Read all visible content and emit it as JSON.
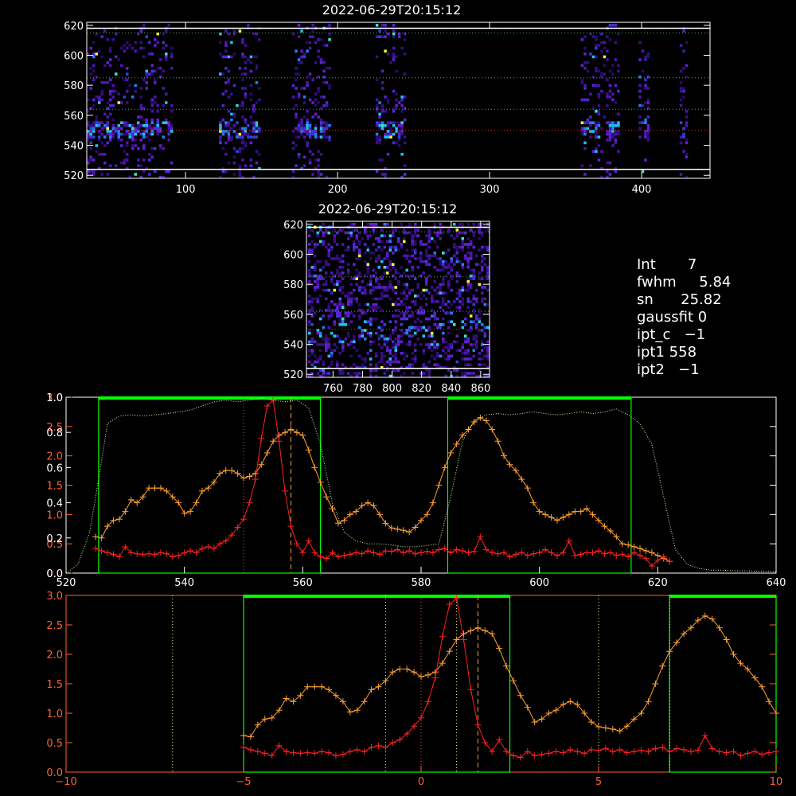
{
  "colors": {
    "background": "#000000",
    "axis": "#ffffff",
    "red": "#ff2020",
    "orange": "#ffa030",
    "green": "#00ff00",
    "lightgreen": "#ccffaa",
    "yellow": "#ffff40"
  },
  "info": {
    "int": {
      "label": "Int",
      "value": "7"
    },
    "fwhm": {
      "label": "fwhm",
      "value": "5.84"
    },
    "sn": {
      "label": "sn",
      "value": "25.82"
    },
    "gaussfit": {
      "label": "gaussfit",
      "value": "0"
    },
    "ipt_c": {
      "label": "ipt_c",
      "value": "−1"
    },
    "ipt1": {
      "label": "ipt1",
      "value": "558"
    },
    "ipt2": {
      "label": "ipt2",
      "value": "−1"
    }
  },
  "chart_data": [
    {
      "type": "heatmap",
      "title": "2022-06-29T20:15:12",
      "xlim": [
        35,
        445
      ],
      "ylim": [
        518,
        622
      ],
      "xticks": [
        100,
        200,
        300,
        400
      ],
      "yticks": [
        520,
        540,
        560,
        580,
        600,
        620
      ],
      "hlines": {
        "white": [
          524,
          618
        ],
        "green": [
          564,
          585,
          615
        ],
        "red": [
          550
        ]
      },
      "bright_columns": [
        [
          35,
          90
        ],
        [
          122,
          148
        ],
        [
          170,
          195
        ],
        [
          225,
          245
        ],
        [
          360,
          385
        ],
        [
          398,
          405
        ],
        [
          425,
          429
        ]
      ]
    },
    {
      "type": "heatmap",
      "title": "2022-06-29T20:15:12",
      "xlim": [
        742,
        866
      ],
      "ylim": [
        518,
        622
      ],
      "xticks": [
        760,
        780,
        800,
        820,
        840,
        860
      ],
      "yticks": [
        520,
        540,
        560,
        580,
        600,
        620
      ],
      "hlines": {
        "white": [
          524,
          618
        ],
        "green": [
          562,
          585,
          615
        ],
        "red": [
          550
        ]
      }
    },
    {
      "type": "line",
      "xlim": [
        520,
        640
      ],
      "xticks": [
        520,
        540,
        560,
        580,
        600,
        620,
        640
      ],
      "yticks_left_red": [
        0.0,
        0.5,
        1.0,
        1.5,
        2.0,
        2.5,
        3.0
      ],
      "yticks_left_white": [
        0.0,
        0.2,
        0.4,
        0.6,
        0.8,
        1.0
      ],
      "ylim": [
        0,
        3.0
      ],
      "green_boxes": [
        [
          525.5,
          563
        ],
        [
          584.5,
          615.5
        ]
      ],
      "vlines": {
        "red_dotted": [
          550
        ],
        "orange_dashed": [
          558
        ]
      },
      "series": [
        {
          "color": "orange",
          "x": [
            525,
            526,
            527,
            528,
            529,
            530,
            531,
            532,
            533,
            534,
            535,
            536,
            537,
            538,
            539,
            540,
            541,
            542,
            543,
            544,
            545,
            546,
            547,
            548,
            549,
            550,
            551,
            552,
            553,
            554,
            555,
            556,
            557,
            558,
            559,
            560,
            561,
            562,
            563,
            564,
            565,
            566,
            567,
            568,
            569,
            570,
            571,
            572,
            573,
            574,
            575,
            576,
            577,
            578,
            579,
            580,
            581,
            582,
            583,
            584,
            585,
            586,
            587,
            588,
            589,
            590,
            591,
            592,
            593,
            594,
            595,
            596,
            597,
            598,
            599,
            600,
            601,
            602,
            603,
            604,
            605,
            606,
            607,
            608,
            609,
            610,
            611,
            612,
            613,
            614,
            615,
            616,
            617,
            618,
            619,
            620,
            621,
            622
          ],
          "values": [
            0.62,
            0.6,
            0.8,
            0.9,
            0.92,
            1.05,
            1.25,
            1.2,
            1.3,
            1.45,
            1.45,
            1.45,
            1.4,
            1.3,
            1.2,
            1.02,
            1.05,
            1.2,
            1.4,
            1.45,
            1.55,
            1.7,
            1.75,
            1.75,
            1.7,
            1.62,
            1.65,
            1.7,
            1.85,
            2.05,
            2.25,
            2.35,
            2.4,
            2.45,
            2.4,
            2.35,
            2.1,
            1.8,
            1.55,
            1.3,
            1.1,
            0.85,
            0.9,
            1.0,
            1.05,
            1.15,
            1.2,
            1.15,
            1.0,
            0.85,
            0.77,
            0.75,
            0.73,
            0.7,
            0.78,
            0.9,
            1.0,
            1.2,
            1.5,
            1.8,
            2.05,
            2.2,
            2.35,
            2.45,
            2.58,
            2.65,
            2.6,
            2.45,
            2.25,
            2.0,
            1.85,
            1.75,
            1.6,
            1.45,
            1.2,
            1.05,
            1.0,
            0.95,
            0.9,
            0.95,
            1.0,
            1.05,
            1.05,
            1.1,
            1.0,
            0.9,
            0.8,
            0.72,
            0.62,
            0.5,
            0.48,
            0.45,
            0.42,
            0.38,
            0.35,
            0.3,
            0.25,
            0.2
          ]
        },
        {
          "color": "red",
          "x": [
            525,
            526,
            527,
            528,
            529,
            530,
            531,
            532,
            533,
            534,
            535,
            536,
            537,
            538,
            539,
            540,
            541,
            542,
            543,
            544,
            545,
            546,
            547,
            548,
            549,
            550,
            551,
            552,
            553,
            554,
            555,
            556,
            557,
            558,
            559,
            560,
            561,
            562,
            563,
            564,
            565,
            566,
            567,
            568,
            569,
            570,
            571,
            572,
            573,
            574,
            575,
            576,
            577,
            578,
            579,
            580,
            581,
            582,
            583,
            584,
            585,
            586,
            587,
            588,
            589,
            590,
            591,
            592,
            593,
            594,
            595,
            596,
            597,
            598,
            599,
            600,
            601,
            602,
            603,
            604,
            605,
            606,
            607,
            608,
            609,
            610,
            611,
            612,
            613,
            614,
            615,
            616,
            617,
            618,
            619,
            620,
            621,
            622
          ],
          "values": [
            0.42,
            0.38,
            0.35,
            0.32,
            0.28,
            0.45,
            0.35,
            0.33,
            0.32,
            0.33,
            0.32,
            0.35,
            0.33,
            0.28,
            0.3,
            0.35,
            0.38,
            0.35,
            0.42,
            0.45,
            0.42,
            0.5,
            0.55,
            0.65,
            0.78,
            0.92,
            1.2,
            1.6,
            2.3,
            2.85,
            2.95,
            2.25,
            1.4,
            0.8,
            0.5,
            0.35,
            0.55,
            0.35,
            0.28,
            0.25,
            0.35,
            0.28,
            0.3,
            0.32,
            0.35,
            0.33,
            0.38,
            0.35,
            0.32,
            0.38,
            0.37,
            0.4,
            0.35,
            0.38,
            0.33,
            0.35,
            0.37,
            0.35,
            0.4,
            0.42,
            0.35,
            0.4,
            0.38,
            0.35,
            0.37,
            0.62,
            0.4,
            0.35,
            0.33,
            0.35,
            0.28,
            0.32,
            0.35,
            0.3,
            0.33,
            0.35,
            0.4,
            0.35,
            0.3,
            0.35,
            0.55,
            0.3,
            0.32,
            0.35,
            0.35,
            0.38,
            0.33,
            0.35,
            0.3,
            0.32,
            0.28,
            0.35,
            0.3,
            0.25,
            0.12,
            0.22,
            0.28,
            0.2
          ]
        },
        {
          "color": "lightgreen",
          "style": "dotted",
          "x": [
            520,
            522,
            524,
            525.5,
            527,
            529,
            531,
            533,
            535,
            537,
            539,
            541,
            543,
            545,
            547,
            549,
            551,
            553,
            555,
            557,
            559,
            561,
            563,
            565,
            567,
            569,
            571,
            573,
            575,
            577,
            579,
            581,
            583,
            585,
            587,
            589,
            591,
            593,
            595,
            597,
            599,
            601,
            603,
            605,
            607,
            609,
            611,
            613,
            615,
            617,
            619,
            621,
            623,
            625,
            627,
            629,
            631,
            633,
            635,
            637,
            639,
            640
          ],
          "values": [
            0.0,
            0.15,
            0.7,
            1.6,
            2.55,
            2.68,
            2.7,
            2.68,
            2.7,
            2.72,
            2.75,
            2.78,
            2.85,
            2.92,
            2.95,
            2.92,
            2.95,
            2.98,
            2.95,
            2.92,
            2.95,
            2.82,
            2.2,
            1.2,
            0.7,
            0.55,
            0.5,
            0.5,
            0.48,
            0.45,
            0.45,
            0.47,
            0.5,
            1.3,
            2.25,
            2.6,
            2.7,
            2.72,
            2.7,
            2.72,
            2.75,
            2.72,
            2.7,
            2.72,
            2.75,
            2.72,
            2.75,
            2.8,
            2.7,
            2.55,
            2.2,
            1.3,
            0.4,
            0.15,
            0.08,
            0.05,
            0.05,
            0.04,
            0.04,
            0.03,
            0.03,
            0.02
          ]
        }
      ]
    },
    {
      "type": "line",
      "xlim": [
        -10,
        10
      ],
      "xticks": [
        -10,
        -5,
        0,
        5,
        10
      ],
      "yticks": [
        0.0,
        0.5,
        1.0,
        1.5,
        2.0,
        2.5,
        3.0
      ],
      "ylim": [
        0,
        3.0
      ],
      "green_boxes": [
        [
          -5,
          2.5
        ],
        [
          7,
          10
        ]
      ],
      "vlines": {
        "yellow_dotted": [
          -7,
          -1,
          1,
          5,
          7
        ],
        "red_dotted": [
          0
        ],
        "orange_dashed": [
          1.6
        ]
      },
      "series": [
        {
          "color": "orange",
          "x": [
            -5.0,
            -4.8,
            -4.6,
            -4.4,
            -4.2,
            -4.0,
            -3.8,
            -3.6,
            -3.4,
            -3.2,
            -3.0,
            -2.8,
            -2.6,
            -2.4,
            -2.2,
            -2.0,
            -1.8,
            -1.6,
            -1.4,
            -1.2,
            -1.0,
            -0.8,
            -0.6,
            -0.4,
            -0.2,
            0.0,
            0.2,
            0.4,
            0.6,
            0.8,
            1.0,
            1.2,
            1.4,
            1.6,
            1.8,
            2.0,
            2.2,
            2.4,
            2.6,
            2.8,
            3.0,
            3.2,
            3.4,
            3.6,
            3.8,
            4.0,
            4.2,
            4.4,
            4.6,
            4.8,
            5.0,
            5.2,
            5.4,
            5.6,
            5.8,
            6.0,
            6.2,
            6.4,
            6.6,
            6.8,
            7.0,
            7.2,
            7.4,
            7.6,
            7.8,
            8.0,
            8.2,
            8.4,
            8.6,
            8.8,
            9.0,
            9.2,
            9.4,
            9.6,
            9.8,
            10.0
          ],
          "values": [
            0.62,
            0.6,
            0.8,
            0.9,
            0.92,
            1.05,
            1.25,
            1.2,
            1.3,
            1.45,
            1.45,
            1.45,
            1.4,
            1.3,
            1.2,
            1.02,
            1.05,
            1.2,
            1.4,
            1.45,
            1.55,
            1.7,
            1.75,
            1.75,
            1.7,
            1.62,
            1.65,
            1.7,
            1.85,
            2.05,
            2.25,
            2.35,
            2.4,
            2.45,
            2.4,
            2.35,
            2.1,
            1.8,
            1.55,
            1.3,
            1.1,
            0.85,
            0.9,
            1.0,
            1.05,
            1.15,
            1.2,
            1.15,
            1.0,
            0.85,
            0.77,
            0.75,
            0.73,
            0.7,
            0.78,
            0.9,
            1.0,
            1.2,
            1.5,
            1.8,
            2.05,
            2.2,
            2.35,
            2.45,
            2.58,
            2.65,
            2.6,
            2.45,
            2.25,
            2.0,
            1.85,
            1.75,
            1.6,
            1.45,
            1.2,
            1.0
          ]
        },
        {
          "color": "red",
          "x": [
            -5.0,
            -4.8,
            -4.6,
            -4.4,
            -4.2,
            -4.0,
            -3.8,
            -3.6,
            -3.4,
            -3.2,
            -3.0,
            -2.8,
            -2.6,
            -2.4,
            -2.2,
            -2.0,
            -1.8,
            -1.6,
            -1.4,
            -1.2,
            -1.0,
            -0.8,
            -0.6,
            -0.4,
            -0.2,
            0.0,
            0.2,
            0.4,
            0.6,
            0.8,
            1.0,
            1.2,
            1.4,
            1.6,
            1.8,
            2.0,
            2.2,
            2.4,
            2.6,
            2.8,
            3.0,
            3.2,
            3.4,
            3.6,
            3.8,
            4.0,
            4.2,
            4.4,
            4.6,
            4.8,
            5.0,
            5.2,
            5.4,
            5.6,
            5.8,
            6.0,
            6.2,
            6.4,
            6.6,
            6.8,
            7.0,
            7.2,
            7.4,
            7.6,
            7.8,
            8.0,
            8.2,
            8.4,
            8.6,
            8.8,
            9.0,
            9.2,
            9.4,
            9.6,
            9.8,
            10.0
          ],
          "values": [
            0.42,
            0.38,
            0.35,
            0.32,
            0.28,
            0.45,
            0.35,
            0.33,
            0.32,
            0.33,
            0.32,
            0.35,
            0.33,
            0.28,
            0.3,
            0.35,
            0.38,
            0.35,
            0.42,
            0.45,
            0.42,
            0.5,
            0.55,
            0.65,
            0.78,
            0.92,
            1.2,
            1.6,
            2.3,
            2.85,
            2.95,
            2.25,
            1.4,
            0.8,
            0.5,
            0.35,
            0.55,
            0.35,
            0.28,
            0.25,
            0.35,
            0.28,
            0.3,
            0.32,
            0.35,
            0.33,
            0.38,
            0.35,
            0.32,
            0.38,
            0.37,
            0.4,
            0.35,
            0.38,
            0.33,
            0.35,
            0.37,
            0.35,
            0.4,
            0.42,
            0.35,
            0.4,
            0.38,
            0.35,
            0.37,
            0.62,
            0.4,
            0.35,
            0.33,
            0.35,
            0.28,
            0.32,
            0.35,
            0.3,
            0.33,
            0.35
          ]
        }
      ]
    }
  ]
}
